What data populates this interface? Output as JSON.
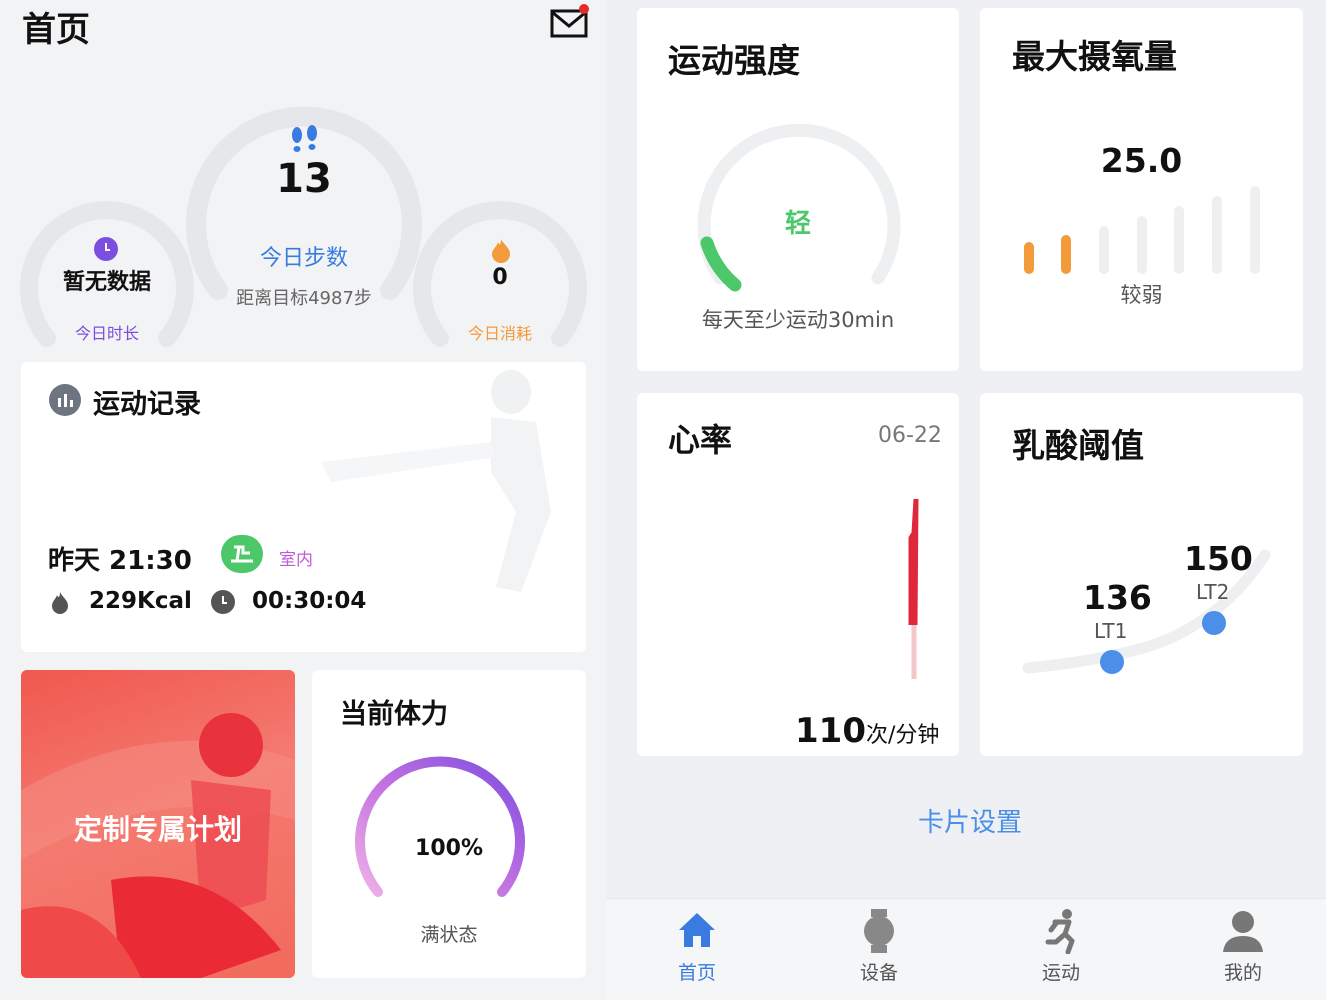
{
  "header": {
    "title": "首页"
  },
  "rings": {
    "duration": {
      "value": "暂无数据",
      "label": "今日时长"
    },
    "steps": {
      "value": "13",
      "label": "今日步数",
      "goal": "距离目标4987步"
    },
    "calories": {
      "value": "0",
      "label": "今日消耗"
    }
  },
  "workout_record": {
    "title": "运动记录",
    "time": "昨天 21:30",
    "badge": "室内",
    "kcal": "229Kcal",
    "duration": "00:30:04"
  },
  "plan_card": {
    "text": "定制专属计划"
  },
  "stamina": {
    "title": "当前体力",
    "percent": "100%",
    "level": 1.0,
    "status": "满状态"
  },
  "intensity": {
    "title": "运动强度",
    "level": "轻",
    "note": "每天至少运动30min"
  },
  "vo2max": {
    "title": "最大摄氧量",
    "value": "25.0",
    "rating": "较弱"
  },
  "heart_rate": {
    "title": "心率",
    "date": "06-22",
    "value": "110",
    "unit": "次/分钟"
  },
  "lactate": {
    "title": "乳酸阈值",
    "lt1_value": "136",
    "lt1_label": "LT1",
    "lt2_value": "150",
    "lt2_label": "LT2"
  },
  "card_settings": {
    "label": "卡片设置"
  },
  "bottom_nav": [
    {
      "label": "首页",
      "icon": "home-icon",
      "active": true
    },
    {
      "label": "设备",
      "icon": "watch-icon",
      "active": false
    },
    {
      "label": "运动",
      "icon": "running-icon",
      "active": false
    },
    {
      "label": "我的",
      "icon": "person-icon",
      "active": false
    }
  ],
  "colors": {
    "accent": "#3a7be0",
    "ring_gray": "#e6e7ea",
    "green": "#4cc76a",
    "orange": "#f39a3a",
    "purple": "#7c4ee0",
    "red": "#e0283c"
  }
}
